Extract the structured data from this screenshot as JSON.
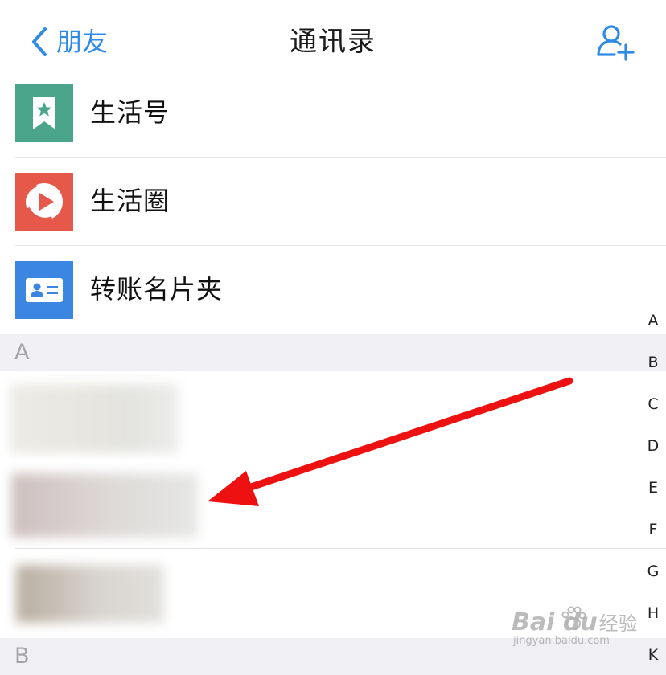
{
  "nav": {
    "back_label": "朋友",
    "title": "通讯录",
    "back_icon": "chevron-left-icon",
    "add_icon": "add-friend-icon"
  },
  "entries": [
    {
      "label": "生活号",
      "icon": "bookmark-star-icon",
      "color": "#4aa58a"
    },
    {
      "label": "生活圈",
      "icon": "play-circle-icon",
      "color": "#e6594a"
    },
    {
      "label": "转账名片夹",
      "icon": "id-card-icon",
      "color": "#3b86e0"
    }
  ],
  "sections": [
    {
      "letter": "A"
    },
    {
      "letter": "B"
    }
  ],
  "index_letters": [
    "A",
    "B",
    "C",
    "D",
    "E",
    "F",
    "G",
    "H",
    "K"
  ],
  "colors": {
    "accent": "#2f8be6",
    "section_bg": "#efeff4",
    "arrow": "#ee1111"
  },
  "watermark": {
    "brand": "Bai du",
    "suffix": "经验",
    "sub": "jingyan.baidu.com"
  }
}
